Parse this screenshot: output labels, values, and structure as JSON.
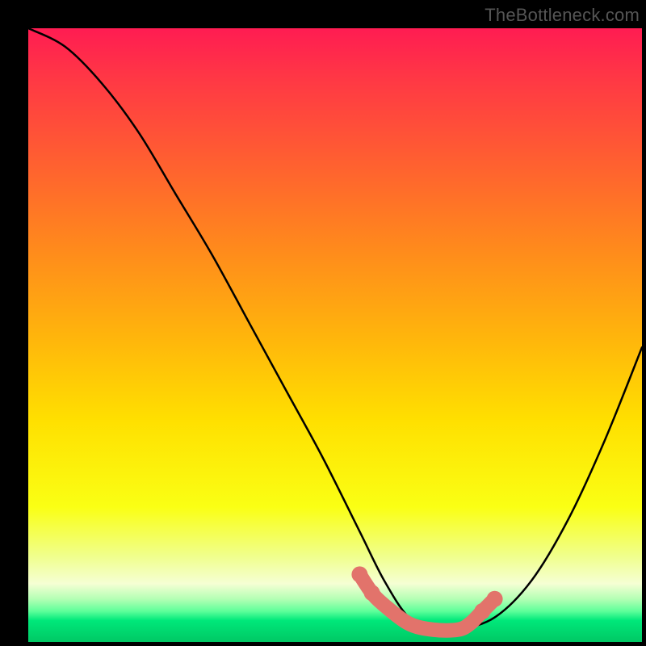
{
  "credit": "TheBottleneck.com",
  "chart_data": {
    "type": "line",
    "title": "",
    "xlabel": "",
    "ylabel": "",
    "xlim": [
      0,
      100
    ],
    "ylim": [
      0,
      100
    ],
    "grid": false,
    "legend": false,
    "series": [
      {
        "name": "bottleneck-curve",
        "x": [
          0,
          6,
          12,
          18,
          24,
          30,
          36,
          42,
          48,
          54,
          58,
          62,
          66,
          70,
          76,
          82,
          88,
          94,
          100
        ],
        "values": [
          100,
          97,
          91,
          83,
          73,
          63,
          52,
          41,
          30,
          18,
          10,
          4,
          2,
          2,
          4,
          10,
          20,
          33,
          48
        ]
      },
      {
        "name": "highlight-flat-region",
        "x": [
          54,
          56,
          58,
          62,
          66,
          70,
          72,
          74,
          76
        ],
        "values": [
          11,
          8,
          6,
          3,
          2,
          2,
          3,
          5,
          7
        ]
      }
    ],
    "gradient_stops": [
      {
        "pos": 0.0,
        "color": "#ff1c52"
      },
      {
        "pos": 0.08,
        "color": "#ff3745"
      },
      {
        "pos": 0.22,
        "color": "#ff6030"
      },
      {
        "pos": 0.36,
        "color": "#ff8a1c"
      },
      {
        "pos": 0.5,
        "color": "#ffb40c"
      },
      {
        "pos": 0.64,
        "color": "#ffe000"
      },
      {
        "pos": 0.78,
        "color": "#faff14"
      },
      {
        "pos": 0.86,
        "color": "#f0ff8c"
      },
      {
        "pos": 0.905,
        "color": "#f5ffd4"
      },
      {
        "pos": 0.93,
        "color": "#b4ffb4"
      },
      {
        "pos": 0.95,
        "color": "#5dff9a"
      },
      {
        "pos": 0.965,
        "color": "#00e87a"
      },
      {
        "pos": 1.0,
        "color": "#00c864"
      }
    ],
    "curve_color": "#000000",
    "highlight_color": "#e2736b"
  }
}
